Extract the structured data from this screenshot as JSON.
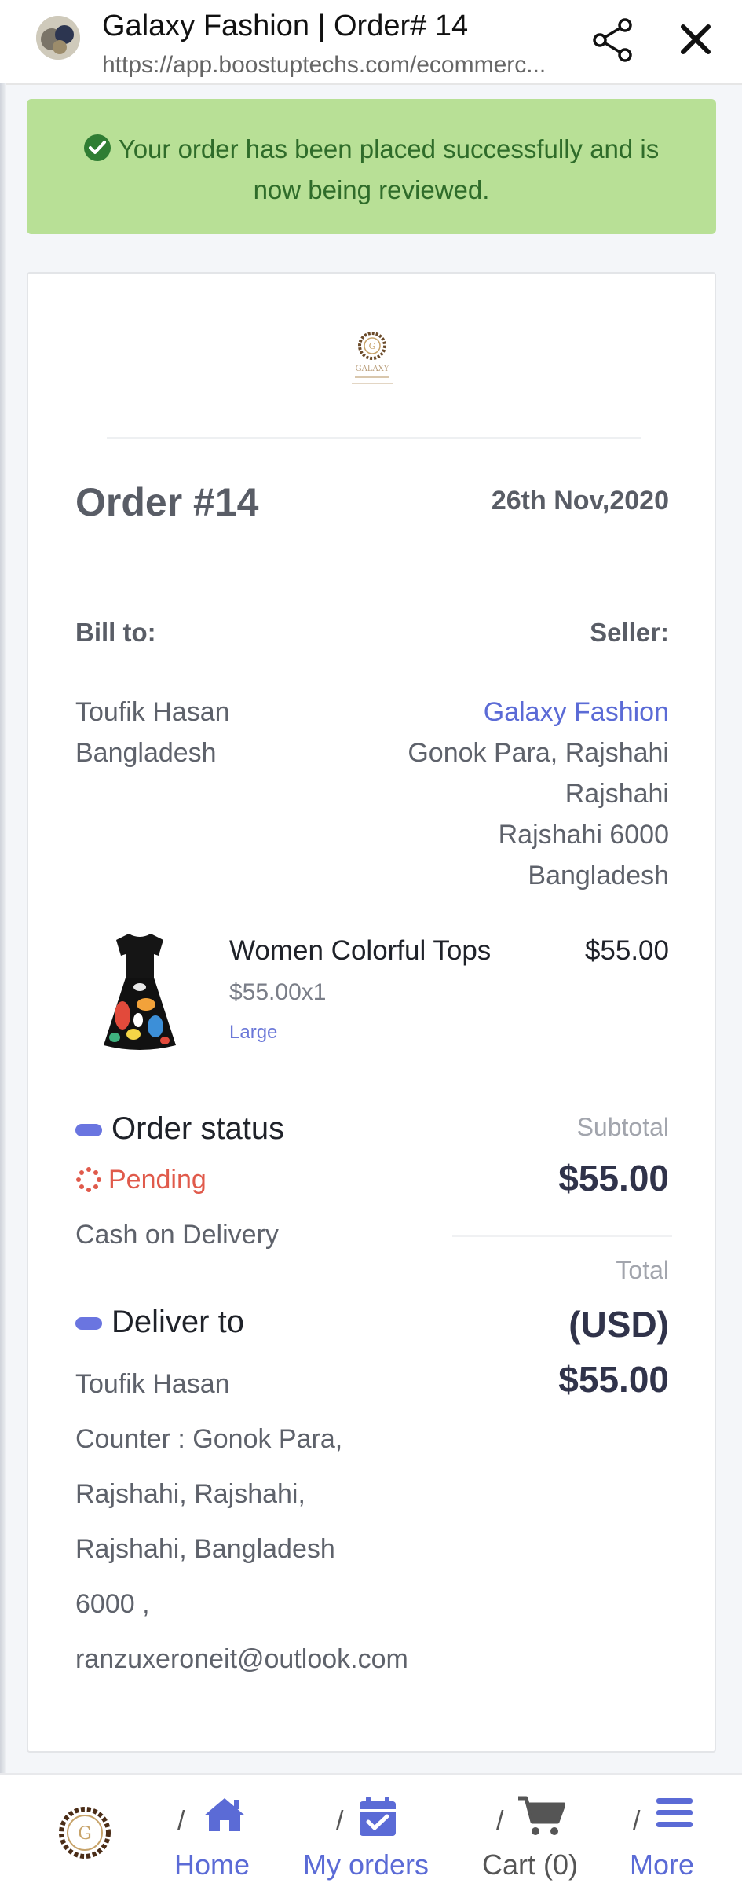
{
  "browser": {
    "title": "Galaxy Fashion | Order# 14",
    "url": "https://app.boostuptechs.com/ecommerc..."
  },
  "banner": {
    "message": "Your order has been placed successfully and is now being reviewed."
  },
  "order": {
    "number": "Order #14",
    "date": "26th Nov,2020",
    "bill_label": "Bill to:",
    "seller_label": "Seller:",
    "bill_to": [
      "Toufik Hasan",
      "Bangladesh"
    ],
    "seller": {
      "name": "Galaxy Fashion",
      "address": [
        "Gonok Para, Rajshahi",
        "Rajshahi",
        "Rajshahi 6000",
        "Bangladesh"
      ]
    }
  },
  "item": {
    "name": "Women Colorful Tops",
    "price": "$55.00",
    "qty": "$55.00x1",
    "size": "Large"
  },
  "status": {
    "title": "Order status",
    "value": "Pending",
    "payment": "Cash on Delivery"
  },
  "deliver": {
    "title": "Deliver to",
    "lines": [
      "Toufik Hasan",
      "Counter : Gonok Para,",
      "Rajshahi, Rajshahi,",
      "Rajshahi, Bangladesh",
      "6000 ,",
      "ranzuxeroneit@outlook.com"
    ]
  },
  "summary": {
    "subtotal_label": "Subtotal",
    "subtotal": "$55.00",
    "total_label": "Total",
    "currency": "(USD)",
    "total": "$55.00"
  },
  "nav": {
    "slash": "/",
    "items": [
      {
        "label": "Home",
        "icon": "home-icon"
      },
      {
        "label": "My orders",
        "icon": "calendar-check-icon"
      },
      {
        "label": "Cart (0)",
        "icon": "cart-icon"
      },
      {
        "label": "More",
        "icon": "menu-icon"
      }
    ]
  },
  "colors": {
    "accent": "#5b6bd6",
    "success_bg": "#b8e096",
    "success_text": "#2f6c2a",
    "pending": "#e05a4b"
  }
}
